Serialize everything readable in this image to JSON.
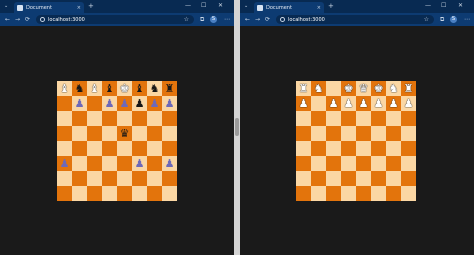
{
  "browser": {
    "tab_title": "Document",
    "url": "localhost:3000",
    "new_tab_label": "+",
    "profile_initial": "S"
  },
  "colors": {
    "light_square": "#fbd7a4",
    "dark_square": "#e3740c",
    "purple_piece": "#6e6ab8",
    "chrome_bg": "#0d3b72",
    "page_bg": "#1a1a1a"
  },
  "icons": {
    "back": "←",
    "forward": "→",
    "reload": "⟳",
    "star": "☆",
    "extensions": "⧉",
    "menu": "⋯",
    "close": "✕",
    "minimize": "—",
    "maximize": "☐",
    "chevron": "⌄",
    "tab_close": "×"
  },
  "boards": [
    {
      "name": "left",
      "rows": [
        [
          "wb",
          "bn",
          "wb",
          "bb",
          "wK",
          "bb",
          "bn",
          "bR"
        ],
        [
          "",
          "pp",
          "",
          "pp",
          "pp",
          "bp",
          "pp",
          "pp"
        ],
        [
          "",
          "",
          "",
          "",
          "",
          "",
          "",
          ""
        ],
        [
          "",
          "",
          "",
          "",
          "bQ",
          "",
          "",
          ""
        ],
        [
          "",
          "",
          "",
          "",
          "",
          "",
          "",
          ""
        ],
        [
          "pp",
          "",
          "",
          "",
          "",
          "pp",
          "",
          "pp"
        ],
        [
          "",
          "",
          "",
          "",
          "",
          "",
          "",
          ""
        ],
        [
          "",
          "",
          "",
          "",
          "",
          "",
          "",
          ""
        ]
      ]
    },
    {
      "name": "right",
      "rows": [
        [
          "wR",
          "wN",
          "",
          "wK",
          "wQ",
          "wK",
          "wN",
          "wR"
        ],
        [
          "wp",
          "",
          "wp",
          "wp",
          "wp",
          "wp",
          "wp",
          "wp"
        ],
        [
          "",
          "",
          "",
          "",
          "",
          "",
          "",
          ""
        ],
        [
          "",
          "",
          "",
          "",
          "",
          "",
          "",
          ""
        ],
        [
          "",
          "",
          "",
          "",
          "",
          "",
          "",
          ""
        ],
        [
          "",
          "",
          "",
          "",
          "",
          "",
          "",
          ""
        ],
        [
          "",
          "",
          "",
          "",
          "",
          "",
          "",
          ""
        ],
        [
          "",
          "",
          "",
          "",
          "",
          "",
          "",
          ""
        ]
      ]
    }
  ]
}
